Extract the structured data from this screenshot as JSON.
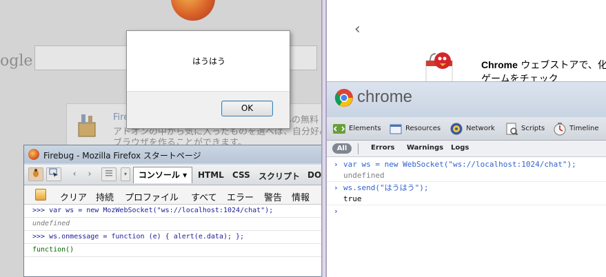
{
  "firefox_page": {
    "google_partial": "ogle",
    "panel_link": "Fire",
    "panel_line1_tail": "んの無料",
    "panel_line2": "アドオンの中から気に入ったものを選べば、自分好み",
    "panel_line3": "ブラウザを作ることができます。"
  },
  "alert": {
    "message": "はうはう",
    "ok_label": "OK"
  },
  "firebug": {
    "window_title": "Firebug - Mozilla Firefox スタートページ",
    "toolbar": {
      "back_glyph": "‹",
      "forward_glyph": "›",
      "console_tab": "コンソール ▾",
      "tabs": [
        "HTML",
        "CSS",
        "スクリプト",
        "DOM"
      ]
    },
    "subbar": [
      "クリア",
      "持続",
      "プロファイル",
      "すべて",
      "エラー",
      "警告",
      "情報"
    ],
    "log": [
      {
        "text": ">>> var ws = new MozWebSocket(\"ws://localhost:1024/chat\");",
        "kind": "command"
      },
      {
        "text": "undefined",
        "kind": "result-undefined"
      },
      {
        "text": ">>> ws.onmessage = function (e) { alert(e.data); };",
        "kind": "command"
      },
      {
        "text": "function()",
        "kind": "result-function"
      }
    ],
    "colors": {
      "command": "#1b1b98",
      "undefined": "#777777",
      "function": "#006400"
    }
  },
  "chrome_page": {
    "back_glyph": "‹",
    "store_title_bold": "Chrome",
    "store_title_rest": " ウェブストアで、化",
    "store_subtitle": "ゲームをチェック"
  },
  "devtools": {
    "brand": "chrome",
    "tools": [
      {
        "label": "Elements",
        "icon": "elements-icon"
      },
      {
        "label": "Resources",
        "icon": "resources-icon"
      },
      {
        "label": "Network",
        "icon": "network-icon"
      },
      {
        "label": "Scripts",
        "icon": "scripts-icon"
      },
      {
        "label": "Timeline",
        "icon": "timeline-icon"
      }
    ],
    "filters": {
      "all": "All",
      "errors": "Errors",
      "warnings": "Warnings",
      "logs": "Logs"
    },
    "console": [
      {
        "text": "var ws = new WebSocket(\"ws://localhost:1024/chat\");",
        "kind": "command"
      },
      {
        "text": "undefined",
        "kind": "result-undefined"
      },
      {
        "text": "ws.send(\"はうはう\");",
        "kind": "command"
      },
      {
        "text": "true",
        "kind": "result"
      }
    ],
    "prompt_glyph": "›",
    "colors": {
      "command": "#2f5fd0",
      "undefined": "#808080",
      "result": "#000000"
    }
  }
}
